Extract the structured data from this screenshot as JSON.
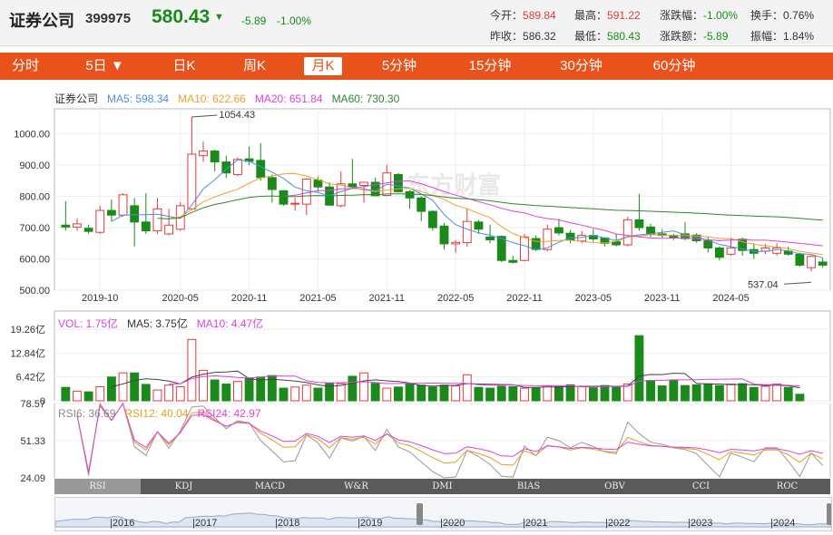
{
  "header": {
    "name": "证券公司",
    "code": "399975",
    "price": "580.43",
    "arrow": "▼",
    "change": "-5.89",
    "change_pct": "-1.00%",
    "stats": [
      {
        "label": "今开：",
        "value": "589.84",
        "color": "red"
      },
      {
        "label": "最高：",
        "value": "591.22",
        "color": "red"
      },
      {
        "label": "涨跌幅：",
        "value": "-1.00%",
        "color": "green"
      },
      {
        "label": "换手：",
        "value": "0.76%",
        "color": "plain"
      },
      {
        "label": "昨收：",
        "value": "586.32",
        "color": "plain"
      },
      {
        "label": "最低：",
        "value": "580.43",
        "color": "green"
      },
      {
        "label": "涨跌额：",
        "value": "-5.89",
        "color": "green"
      },
      {
        "label": "振幅：",
        "value": "1.84%",
        "color": "plain"
      }
    ]
  },
  "tabs": [
    "分时",
    "5日 ▼",
    "日K",
    "周K",
    "月K",
    "5分钟",
    "15分钟",
    "30分钟",
    "60分钟"
  ],
  "active_tab": "月K",
  "kline": {
    "legend": {
      "name": "证券公司",
      "ma5": "MA5: 598.34",
      "ma10": "MA10: 622.66",
      "ma20": "MA20: 651.84",
      "ma60": "MA60: 730.30"
    },
    "colors": {
      "up": "#e4393c",
      "down": "#1a8a1a",
      "ma5": "#4a90e2",
      "ma10": "#f0a030",
      "ma20": "#e040e0",
      "ma60": "#2a8a2a"
    },
    "y_ticks": [
      "1000.00",
      "900.00",
      "800.00",
      "700.00",
      "600.00",
      "500.00"
    ],
    "x_ticks": [
      "2019-10",
      "2020-05",
      "2020-11",
      "2021-05",
      "2021-11",
      "2022-05",
      "2022-11",
      "2023-05",
      "2023-11",
      "2024-05"
    ],
    "max_label": "1054.43",
    "min_label": "537.04",
    "watermark": "东方财富"
  },
  "volume": {
    "legend": {
      "vol": "VOL: 1.75亿",
      "ma5": "MA5: 3.75亿",
      "ma10": "MA10: 4.47亿"
    },
    "y_ticks": [
      "19.26亿",
      "12.84亿",
      "6.42亿",
      "0"
    ]
  },
  "rsi": {
    "legend": {
      "rsi6": "RSI6: 36.69",
      "rsi12": "RSI12: 40.04",
      "rsi24": "RSI24: 42.97"
    },
    "y_ticks": [
      "78.57",
      "51.33",
      "24.09"
    ]
  },
  "indicators": [
    "RSI",
    "KDJ",
    "MACD",
    "W&R",
    "DMI",
    "BIAS",
    "OBV",
    "CCI",
    "ROC"
  ],
  "active_indicator": "RSI",
  "nav_years": [
    "2016",
    "2017",
    "2018",
    "2019",
    "2020",
    "2021",
    "2022",
    "2023",
    "2024"
  ],
  "chart_data": {
    "type": "candlestick",
    "period": "monthly",
    "candles": [
      {
        "o": 708,
        "c": 702,
        "h": 785,
        "l": 690
      },
      {
        "o": 702,
        "c": 712,
        "h": 730,
        "l": 690
      },
      {
        "o": 698,
        "c": 688,
        "h": 710,
        "l": 680
      },
      {
        "o": 685,
        "c": 755,
        "h": 770,
        "l": 680
      },
      {
        "o": 755,
        "c": 740,
        "h": 790,
        "l": 720
      },
      {
        "o": 740,
        "c": 805,
        "h": 810,
        "l": 735
      },
      {
        "o": 770,
        "c": 718,
        "h": 795,
        "l": 640
      },
      {
        "o": 718,
        "c": 690,
        "h": 810,
        "l": 680
      },
      {
        "o": 690,
        "c": 760,
        "h": 795,
        "l": 680
      },
      {
        "o": 680,
        "c": 708,
        "h": 760,
        "l": 676
      },
      {
        "o": 695,
        "c": 770,
        "h": 782,
        "l": 690
      },
      {
        "o": 760,
        "c": 935,
        "h": 1054,
        "l": 755
      },
      {
        "o": 930,
        "c": 945,
        "h": 975,
        "l": 910
      },
      {
        "o": 945,
        "c": 910,
        "h": 950,
        "l": 880
      },
      {
        "o": 910,
        "c": 875,
        "h": 930,
        "l": 860
      },
      {
        "o": 870,
        "c": 918,
        "h": 925,
        "l": 865
      },
      {
        "o": 920,
        "c": 912,
        "h": 960,
        "l": 900
      },
      {
        "o": 915,
        "c": 860,
        "h": 970,
        "l": 850
      },
      {
        "o": 860,
        "c": 822,
        "h": 870,
        "l": 780
      },
      {
        "o": 818,
        "c": 775,
        "h": 820,
        "l": 770
      },
      {
        "o": 775,
        "c": 778,
        "h": 795,
        "l": 755
      },
      {
        "o": 775,
        "c": 855,
        "h": 858,
        "l": 740
      },
      {
        "o": 852,
        "c": 830,
        "h": 862,
        "l": 815
      },
      {
        "o": 830,
        "c": 772,
        "h": 845,
        "l": 770
      },
      {
        "o": 770,
        "c": 840,
        "h": 880,
        "l": 765
      },
      {
        "o": 840,
        "c": 830,
        "h": 920,
        "l": 825
      },
      {
        "o": 835,
        "c": 845,
        "h": 845,
        "l": 780
      },
      {
        "o": 845,
        "c": 802,
        "h": 860,
        "l": 800
      },
      {
        "o": 803,
        "c": 875,
        "h": 900,
        "l": 800
      },
      {
        "o": 870,
        "c": 815,
        "h": 875,
        "l": 812
      },
      {
        "o": 815,
        "c": 795,
        "h": 820,
        "l": 760
      },
      {
        "o": 795,
        "c": 752,
        "h": 800,
        "l": 720
      },
      {
        "o": 752,
        "c": 700,
        "h": 755,
        "l": 690
      },
      {
        "o": 705,
        "c": 648,
        "h": 715,
        "l": 630
      },
      {
        "o": 648,
        "c": 653,
        "h": 660,
        "l": 620
      },
      {
        "o": 652,
        "c": 720,
        "h": 762,
        "l": 640
      },
      {
        "o": 718,
        "c": 695,
        "h": 725,
        "l": 680
      },
      {
        "o": 670,
        "c": 661,
        "h": 710,
        "l": 650
      },
      {
        "o": 672,
        "c": 595,
        "h": 675,
        "l": 590
      },
      {
        "o": 595,
        "c": 589,
        "h": 610,
        "l": 585
      },
      {
        "o": 595,
        "c": 670,
        "h": 680,
        "l": 592
      },
      {
        "o": 665,
        "c": 630,
        "h": 675,
        "l": 625
      },
      {
        "o": 630,
        "c": 695,
        "h": 710,
        "l": 625
      },
      {
        "o": 700,
        "c": 683,
        "h": 728,
        "l": 675
      },
      {
        "o": 682,
        "c": 660,
        "h": 693,
        "l": 650
      },
      {
        "o": 657,
        "c": 675,
        "h": 690,
        "l": 650
      },
      {
        "o": 675,
        "c": 664,
        "h": 695,
        "l": 655
      },
      {
        "o": 667,
        "c": 650,
        "h": 670,
        "l": 640
      },
      {
        "o": 655,
        "c": 645,
        "h": 680,
        "l": 640
      },
      {
        "o": 645,
        "c": 725,
        "h": 735,
        "l": 640
      },
      {
        "o": 725,
        "c": 700,
        "h": 808,
        "l": 690
      },
      {
        "o": 702,
        "c": 680,
        "h": 712,
        "l": 670
      },
      {
        "o": 680,
        "c": 675,
        "h": 695,
        "l": 668
      },
      {
        "o": 675,
        "c": 668,
        "h": 680,
        "l": 660
      },
      {
        "o": 680,
        "c": 665,
        "h": 718,
        "l": 660
      },
      {
        "o": 676,
        "c": 658,
        "h": 682,
        "l": 652
      },
      {
        "o": 658,
        "c": 635,
        "h": 670,
        "l": 620
      },
      {
        "o": 635,
        "c": 605,
        "h": 640,
        "l": 595
      },
      {
        "o": 615,
        "c": 635,
        "h": 668,
        "l": 610
      },
      {
        "o": 663,
        "c": 627,
        "h": 668,
        "l": 610
      },
      {
        "o": 630,
        "c": 618,
        "h": 650,
        "l": 600
      },
      {
        "o": 625,
        "c": 635,
        "h": 648,
        "l": 615
      },
      {
        "o": 618,
        "c": 635,
        "h": 650,
        "l": 610
      },
      {
        "o": 625,
        "c": 615,
        "h": 640,
        "l": 610
      },
      {
        "o": 615,
        "c": 580,
        "h": 620,
        "l": 575
      },
      {
        "o": 572,
        "c": 608,
        "h": 612,
        "l": 560
      },
      {
        "o": 590,
        "c": 580,
        "h": 603,
        "l": 572
      }
    ],
    "volumes": [
      3.6,
      2.6,
      2.4,
      3.8,
      6.4,
      7.5,
      7.5,
      4.4,
      2.9,
      4.2,
      3.8,
      16.5,
      8.2,
      5.6,
      4.5,
      5.2,
      6.1,
      6.4,
      6.8,
      3.4,
      3.7,
      4.2,
      3.4,
      4.7,
      4.6,
      6.6,
      7.5,
      4.7,
      3.4,
      3.7,
      4.6,
      4.2,
      3.7,
      4.2,
      4.0,
      7.0,
      3.6,
      3.4,
      3.9,
      3.8,
      3.4,
      3.5,
      4.0,
      3.8,
      4.3,
      3.9,
      3.5,
      4.1,
      3.7,
      4.5,
      17.5,
      5.5,
      4.0,
      5.5,
      4.1,
      4.3,
      4.6,
      4.1,
      4.5,
      4.6,
      3.6,
      3.9,
      4.5,
      3.6,
      1.75
    ],
    "vol_y_range": [
      0,
      19.26
    ],
    "rsi_y_range": [
      24.09,
      78.57
    ],
    "y_range": [
      500,
      1080
    ]
  }
}
